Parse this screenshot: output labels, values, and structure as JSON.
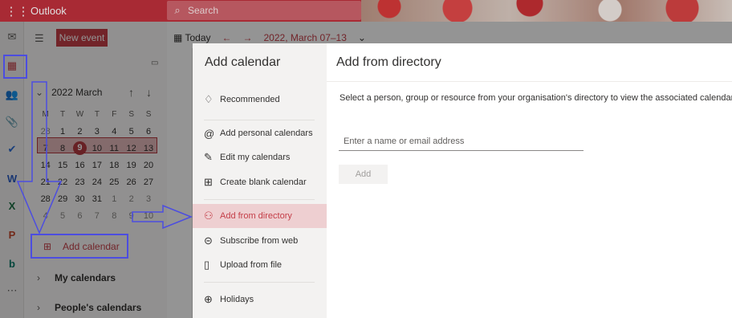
{
  "topbar": {
    "app_name": "Outlook",
    "search_placeholder": "Search"
  },
  "rail": {
    "icons": [
      "mail-icon",
      "calendar-icon",
      "people-icon",
      "attach-icon",
      "todo-icon",
      "word-icon",
      "excel-icon",
      "powerpoint-icon",
      "bookings-icon",
      "more-icon"
    ]
  },
  "sidebar": {
    "new_event_label": "New event",
    "month_year": "2022  March",
    "weekdays": [
      "M",
      "T",
      "W",
      "T",
      "F",
      "S",
      "S"
    ],
    "weeks": [
      [
        "28",
        "1",
        "2",
        "3",
        "4",
        "5",
        "6"
      ],
      [
        "7",
        "8",
        "9",
        "10",
        "11",
        "12",
        "13"
      ],
      [
        "14",
        "15",
        "16",
        "17",
        "18",
        "19",
        "20"
      ],
      [
        "21",
        "22",
        "23",
        "24",
        "25",
        "26",
        "27"
      ],
      [
        "28",
        "29",
        "30",
        "31",
        "1",
        "2",
        "3"
      ],
      [
        "4",
        "5",
        "6",
        "7",
        "8",
        "9",
        "10"
      ]
    ],
    "today_date": "9",
    "add_calendar_label": "Add calendar",
    "my_calendars_label": "My calendars",
    "peoples_calendars_label": "People's calendars"
  },
  "toolbar": {
    "today_label": "Today",
    "range_label": "2022, March 07–13"
  },
  "add_calendar_panel": {
    "title": "Add calendar",
    "items": [
      {
        "label": "Recommended",
        "icon": "lightbulb-icon"
      },
      {
        "label": "Add personal calendars",
        "icon": "at-icon"
      },
      {
        "label": "Edit my calendars",
        "icon": "edit-icon"
      },
      {
        "label": "Create blank calendar",
        "icon": "calendar-plus-icon"
      },
      {
        "label": "Add from directory",
        "icon": "people-icon"
      },
      {
        "label": "Subscribe from web",
        "icon": "globe-icon"
      },
      {
        "label": "Upload from file",
        "icon": "file-icon"
      },
      {
        "label": "Holidays",
        "icon": "globe-icon"
      }
    ]
  },
  "directory_pane": {
    "title": "Add from directory",
    "description": "Select a person, group or resource from your organisation's directory to view the associated calendar.",
    "input_placeholder": "Enter a name or email address",
    "add_button_label": "Add"
  },
  "colors": {
    "accent": "#c43e48",
    "annotation": "#4c4de0",
    "highlight_bg": "#eecfd1"
  }
}
